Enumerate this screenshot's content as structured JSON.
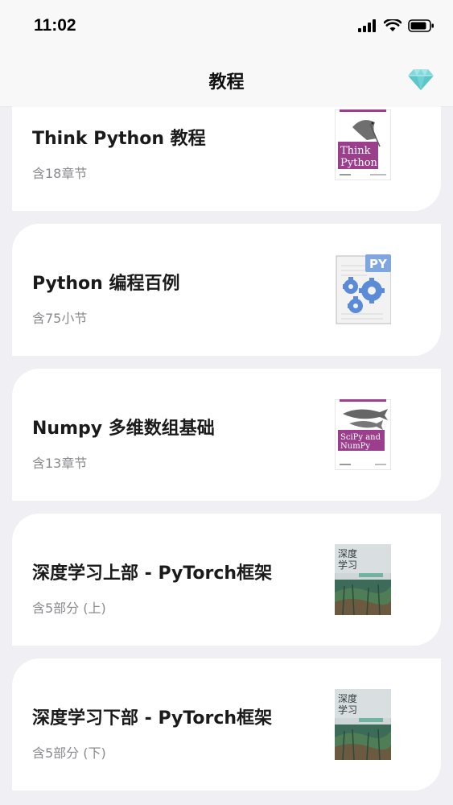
{
  "status_bar": {
    "time": "11:02"
  },
  "nav": {
    "title": "教程"
  },
  "cards": [
    {
      "title": "Think Python 教程",
      "subtitle": "含18章节",
      "cover": {
        "line1": "Think",
        "line2": "Python",
        "color": "#9b3f8c"
      }
    },
    {
      "title": "Python 编程百例",
      "subtitle": "含75小节",
      "cover": {
        "badge": "PY",
        "color": "#5b8bd6"
      }
    },
    {
      "title": "Numpy 多维数组基础",
      "subtitle": "含13章节",
      "cover": {
        "line1": "SciPy and",
        "line2": "NumPy",
        "color": "#9b3f8c"
      }
    },
    {
      "title": "深度学习上部 - PyTorch框架",
      "subtitle": "含5部分 (上)",
      "cover": {
        "line1": "深度",
        "line2": "学习",
        "color": "#3d6b5a"
      }
    },
    {
      "title": "深度学习下部 - PyTorch框架",
      "subtitle": "含5部分 (下)",
      "cover": {
        "line1": "深度",
        "line2": "学习",
        "color": "#3d6b5a"
      }
    }
  ],
  "colors": {
    "background": "#f0eff4",
    "card": "#ffffff",
    "diamond": "#6fd3d6",
    "subtitle": "#8a8a8e"
  }
}
